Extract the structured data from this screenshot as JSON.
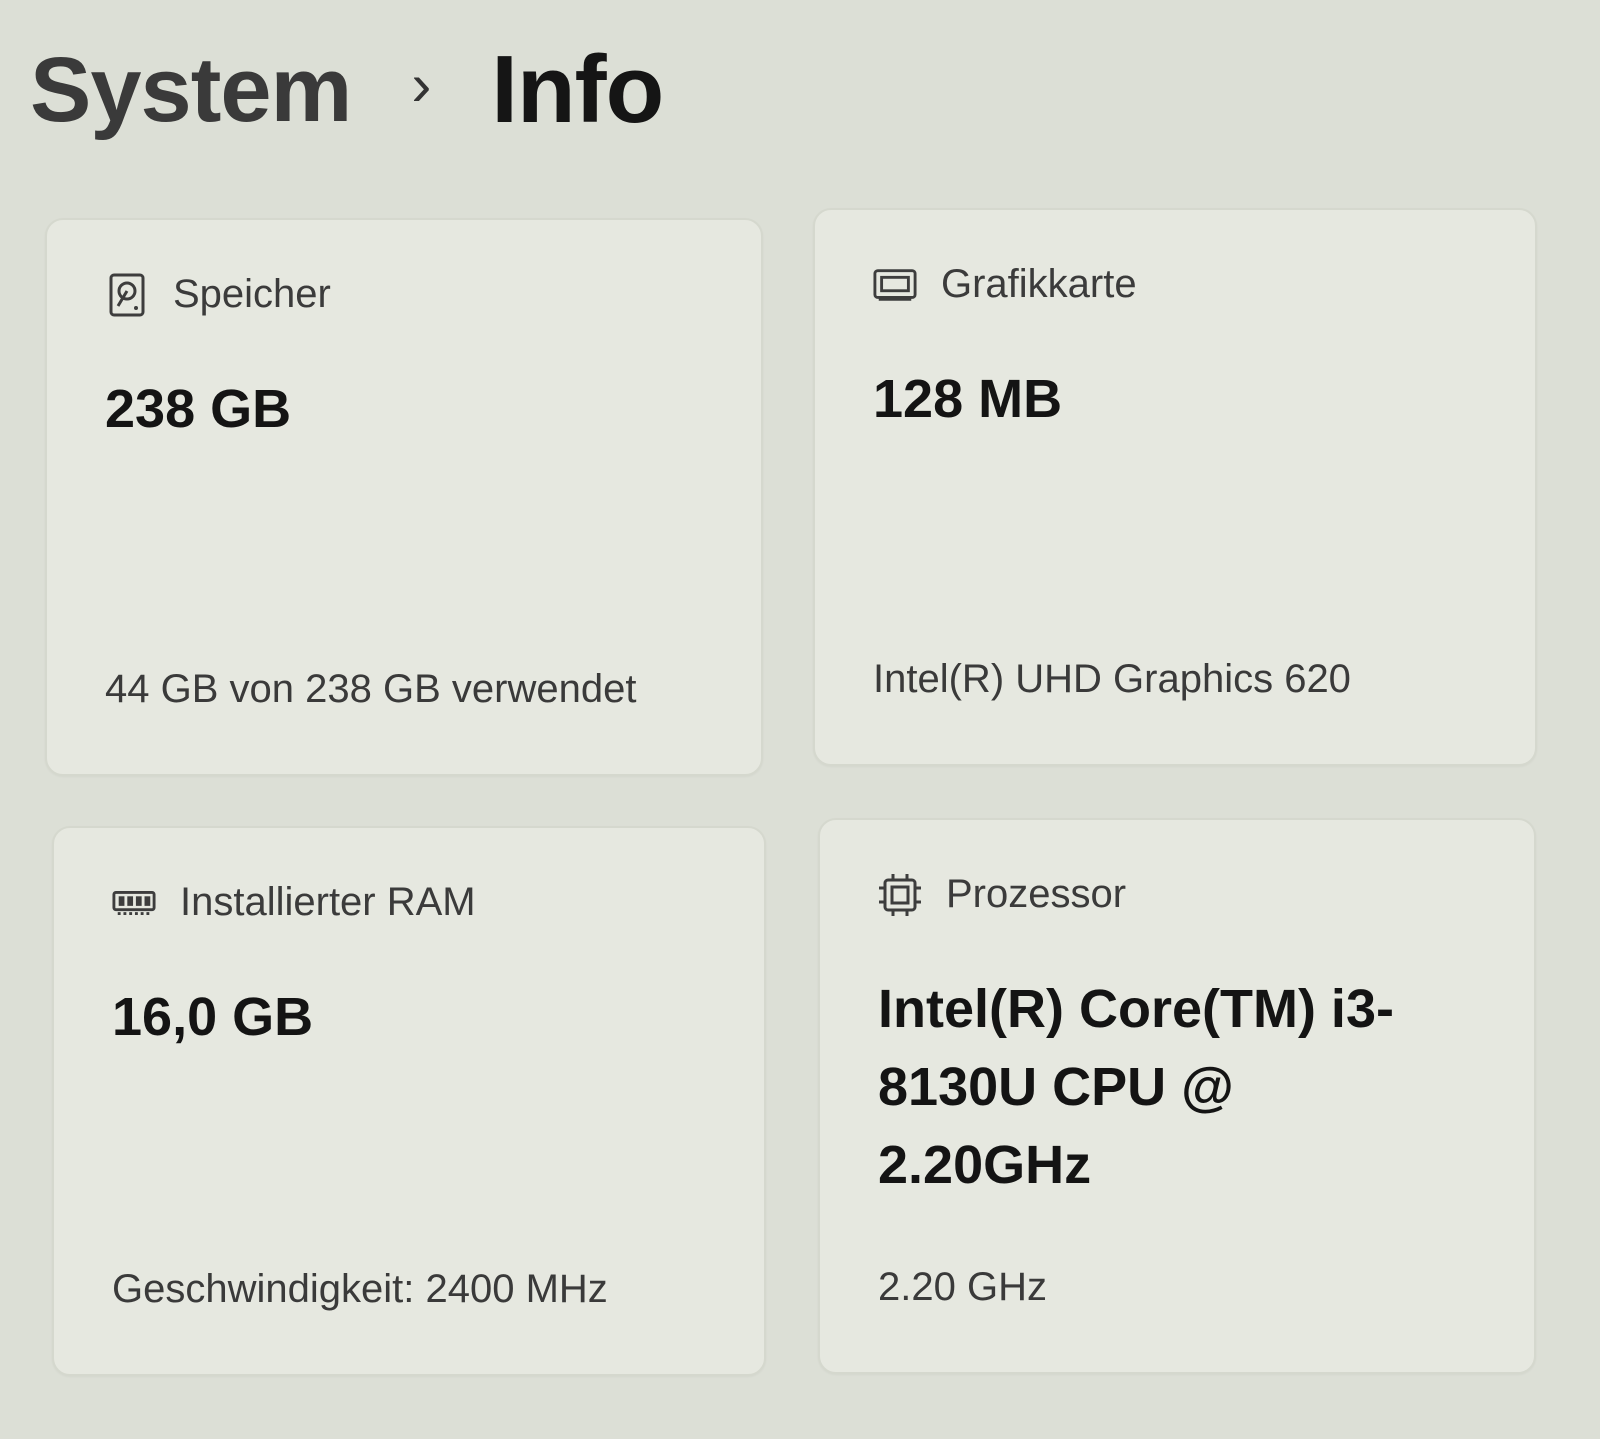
{
  "breadcrumb": {
    "parent": "System",
    "separator": "›",
    "current": "Info"
  },
  "cards": {
    "storage": {
      "icon": "hard-drive-icon",
      "title": "Speicher",
      "value": "238 GB",
      "detail": "44 GB von 238 GB verwendet"
    },
    "gpu": {
      "icon": "graphics-card-icon",
      "title": "Grafikkarte",
      "value": "128 MB",
      "detail": "Intel(R) UHD Graphics 620"
    },
    "ram": {
      "icon": "memory-module-icon",
      "title": "Installierter RAM",
      "value": "16,0 GB",
      "detail": "Geschwindigkeit: 2400 MHz"
    },
    "cpu": {
      "icon": "processor-chip-icon",
      "title": "Prozessor",
      "value": "Intel(R) Core(TM) i3-8130U CPU @ 2.20GHz",
      "detail": "2.20 GHz"
    }
  }
}
